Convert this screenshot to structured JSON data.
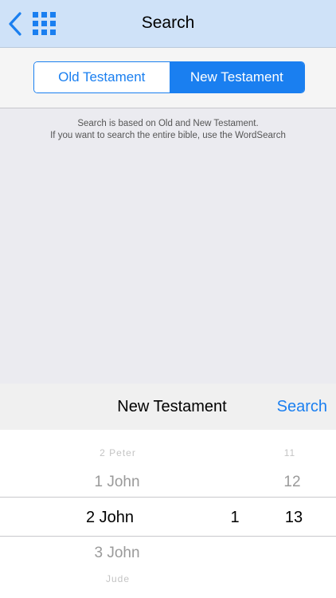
{
  "navbar": {
    "title": "Search",
    "back_icon": "chevron-left-icon",
    "grid_icon": "grid-icon",
    "accent": "#1a7ff0"
  },
  "segmented": {
    "options": [
      "Old Testament",
      "New Testament"
    ],
    "selected": "New Testament"
  },
  "info": {
    "line1": "Search is based on Old and New Testament.",
    "line2": "If you want to search the entire bible, use the WordSearch"
  },
  "picker_toolbar": {
    "title": "New Testament",
    "search_label": "Search"
  },
  "picker": {
    "books": [
      "2 Peter",
      "1 John",
      "2 John",
      "3 John",
      "Jude"
    ],
    "chapter": "1",
    "verses": [
      "11",
      "12",
      "13"
    ],
    "selected_book": "2 John",
    "selected_chapter": "1",
    "selected_verse": "13"
  }
}
